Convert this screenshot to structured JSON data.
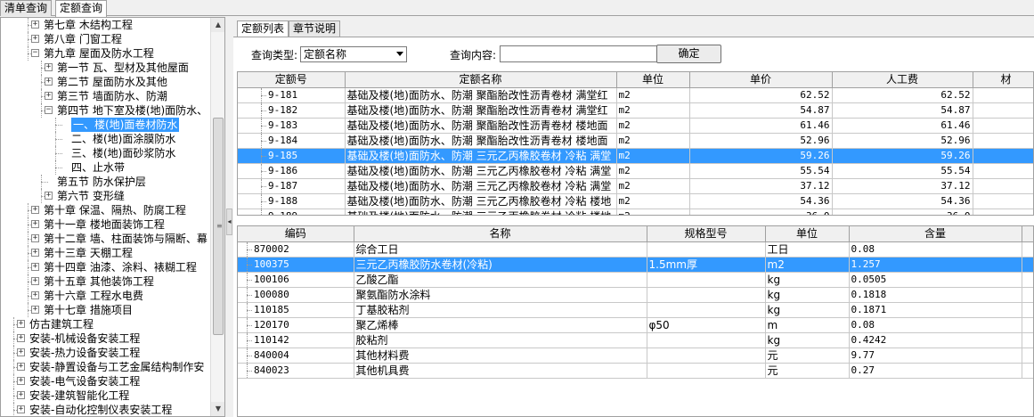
{
  "top_tabs": [
    "清单查询",
    "定额查询"
  ],
  "tree": [
    {
      "label": "第七章 木结构工程",
      "level": 1,
      "expander": "+"
    },
    {
      "label": "第八章 门窗工程",
      "level": 1,
      "expander": "+"
    },
    {
      "label": "第九章 屋面及防水工程",
      "level": 1,
      "expander": "-"
    },
    {
      "label": "第一节 瓦、型材及其他屋面",
      "level": 2,
      "expander": "+"
    },
    {
      "label": "第二节 屋面防水及其他",
      "level": 2,
      "expander": "+"
    },
    {
      "label": "第三节 墙面防水、防潮",
      "level": 2,
      "expander": "+"
    },
    {
      "label": "第四节 地下室及楼(地)面防水、",
      "level": 2,
      "expander": "-"
    },
    {
      "label": "一、楼(地)面卷材防水",
      "level": 3,
      "expander": "",
      "selected": true
    },
    {
      "label": "二、楼(地)面涂膜防水",
      "level": 3,
      "expander": ""
    },
    {
      "label": "三、楼(地)面砂浆防水",
      "level": 3,
      "expander": ""
    },
    {
      "label": "四、止水带",
      "level": 3,
      "expander": ""
    },
    {
      "label": "第五节 防水保护层",
      "level": 2,
      "expander": ""
    },
    {
      "label": "第六节 变形缝",
      "level": 2,
      "expander": "+"
    },
    {
      "label": "第十章 保温、隔热、防腐工程",
      "level": 1,
      "expander": "+"
    },
    {
      "label": "第十一章 楼地面装饰工程",
      "level": 1,
      "expander": "+"
    },
    {
      "label": "第十二章 墙、柱面装饰与隔断、幕",
      "level": 1,
      "expander": "+"
    },
    {
      "label": "第十三章 天棚工程",
      "level": 1,
      "expander": "+"
    },
    {
      "label": "第十四章 油漆、涂料、裱糊工程",
      "level": 1,
      "expander": "+"
    },
    {
      "label": "第十五章 其他装饰工程",
      "level": 1,
      "expander": "+"
    },
    {
      "label": "第十六章 工程水电费",
      "level": 1,
      "expander": "+"
    },
    {
      "label": "第十七章 措施项目",
      "level": 1,
      "expander": "+"
    },
    {
      "label": "仿古建筑工程",
      "level": 0,
      "expander": "+"
    },
    {
      "label": "安装-机械设备安装工程",
      "level": 0,
      "expander": "+"
    },
    {
      "label": "安装-热力设备安装工程",
      "level": 0,
      "expander": "+"
    },
    {
      "label": "安装-静置设备与工艺金属结构制作安",
      "level": 0,
      "expander": "+"
    },
    {
      "label": "安装-电气设备安装工程",
      "level": 0,
      "expander": "+"
    },
    {
      "label": "安装-建筑智能化工程",
      "level": 0,
      "expander": "+"
    },
    {
      "label": "安装-自动化控制仪表安装工程",
      "level": 0,
      "expander": "+"
    }
  ],
  "inner_tabs": [
    "定额列表",
    "章节说明"
  ],
  "query": {
    "type_label": "查询类型:",
    "type_value": "定额名称",
    "content_label": "查询内容:",
    "content_value": "",
    "confirm_label": "确定"
  },
  "quota_table": {
    "headers": [
      "定额号",
      "定额名称",
      "单位",
      "单价",
      "人工费",
      "材"
    ],
    "rows": [
      {
        "code": "9-181",
        "name": "基础及楼(地)面防水、防潮 聚酯胎改性沥青卷材 满堂红",
        "unit": "m2",
        "price": "62.52",
        "labor": "62.52"
      },
      {
        "code": "9-182",
        "name": "基础及楼(地)面防水、防潮 聚酯胎改性沥青卷材 满堂红",
        "unit": "m2",
        "price": "54.87",
        "labor": "54.87"
      },
      {
        "code": "9-183",
        "name": "基础及楼(地)面防水、防潮 聚酯胎改性沥青卷材 楼地面",
        "unit": "m2",
        "price": "61.46",
        "labor": "61.46"
      },
      {
        "code": "9-184",
        "name": "基础及楼(地)面防水、防潮 聚酯胎改性沥青卷材 楼地面",
        "unit": "m2",
        "price": "52.96",
        "labor": "52.96"
      },
      {
        "code": "9-185",
        "name": "基础及楼(地)面防水、防潮 三元乙丙橡胶卷材 冷粘 满堂",
        "unit": "m2",
        "price": "59.26",
        "labor": "59.26",
        "selected": true
      },
      {
        "code": "9-186",
        "name": "基础及楼(地)面防水、防潮 三元乙丙橡胶卷材 冷粘 满堂",
        "unit": "m2",
        "price": "55.54",
        "labor": "55.54"
      },
      {
        "code": "9-187",
        "name": "基础及楼(地)面防水、防潮 三元乙丙橡胶卷材 冷粘 满堂",
        "unit": "m2",
        "price": "37.12",
        "labor": "37.12"
      },
      {
        "code": "9-188",
        "name": "基础及楼(地)面防水、防潮 三元乙丙橡胶卷材 冷粘 楼地",
        "unit": "m2",
        "price": "54.36",
        "labor": "54.36"
      },
      {
        "code": "9-189",
        "name": "基础及楼(地)面防水、防潮 三元乙丙橡胶卷材 冷粘 楼地",
        "unit": "m2",
        "price": "36.0",
        "labor": "36.0"
      }
    ]
  },
  "material_table": {
    "headers": [
      "编码",
      "名称",
      "规格型号",
      "单位",
      "含量"
    ],
    "rows": [
      {
        "code": "870002",
        "name": "综合工日",
        "spec": "",
        "unit": "工日",
        "qty": "0.08"
      },
      {
        "code": "100375",
        "name": "三元乙丙橡胶防水卷材(冷粘)",
        "spec": "1.5mm厚",
        "unit": "m2",
        "qty": "1.257",
        "selected": true
      },
      {
        "code": "100106",
        "name": "乙酸乙酯",
        "spec": "",
        "unit": "kg",
        "qty": "0.0505"
      },
      {
        "code": "100080",
        "name": "聚氨酯防水涂料",
        "spec": "",
        "unit": "kg",
        "qty": "0.1818"
      },
      {
        "code": "110185",
        "name": "丁基胶粘剂",
        "spec": "",
        "unit": "kg",
        "qty": "0.1871"
      },
      {
        "code": "120170",
        "name": "聚乙烯棒",
        "spec": "φ50",
        "unit": "m",
        "qty": "0.08"
      },
      {
        "code": "110142",
        "name": "胶粘剂",
        "spec": "",
        "unit": "kg",
        "qty": "0.4242"
      },
      {
        "code": "840004",
        "name": "其他材料费",
        "spec": "",
        "unit": "元",
        "qty": "9.77"
      },
      {
        "code": "840023",
        "name": "其他机具费",
        "spec": "",
        "unit": "元",
        "qty": "0.27"
      }
    ]
  },
  "colors": {
    "selection": "#3399ff",
    "panel_bg": "#f0f0f0",
    "grid_header": "#f0f0f0"
  }
}
